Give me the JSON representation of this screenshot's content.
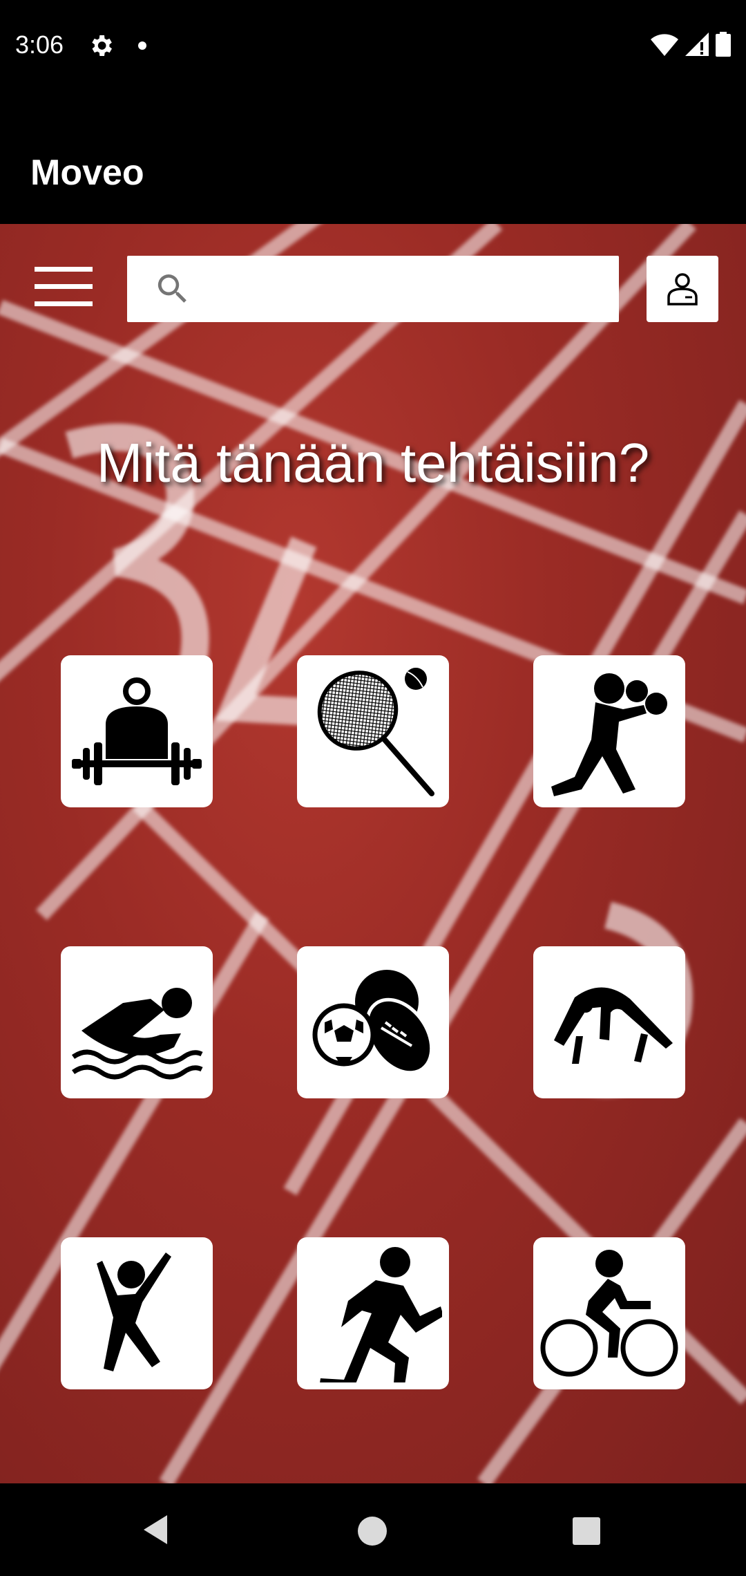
{
  "status_bar": {
    "time": "3:06",
    "icons": [
      "settings-icon",
      "notification-dot",
      "wifi-icon",
      "cellular-icon",
      "battery-icon"
    ]
  },
  "app_bar": {
    "title": "Moveo"
  },
  "toolbar": {
    "menu_icon": "hamburger-menu-icon",
    "search": {
      "placeholder": "",
      "value": "",
      "icon": "search-icon"
    },
    "profile_icon": "person-icon"
  },
  "main": {
    "headline": "Mitä tänään tehtäisiin?",
    "background": "running-track-photo",
    "activities": [
      {
        "icon": "weightlifting-icon"
      },
      {
        "icon": "tennis-icon"
      },
      {
        "icon": "boxing-icon"
      },
      {
        "icon": "swimming-icon"
      },
      {
        "icon": "ball-sports-icon"
      },
      {
        "icon": "gymnastics-icon"
      },
      {
        "icon": "dance-icon"
      },
      {
        "icon": "running-icon"
      },
      {
        "icon": "cycling-icon"
      }
    ]
  },
  "nav_bar": {
    "icons": [
      "back-icon",
      "home-icon",
      "recents-icon"
    ]
  },
  "colors": {
    "track_red": "#9a2b25",
    "tile_bg": "#ffffff",
    "bars": "#000000"
  }
}
